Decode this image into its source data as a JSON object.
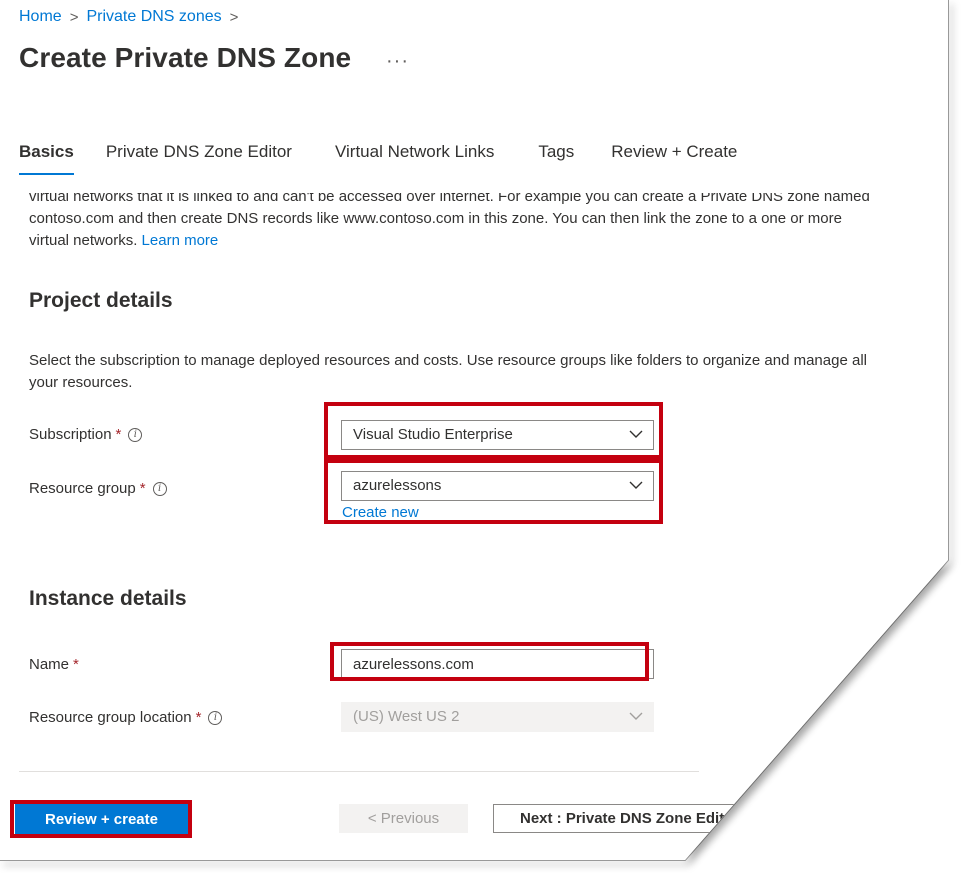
{
  "breadcrumb": {
    "home": "Home",
    "private_dns_zones": "Private DNS zones",
    "separator": ">"
  },
  "page": {
    "title": "Create Private DNS Zone",
    "more": "···"
  },
  "tabs": [
    {
      "label": "Basics",
      "active": true
    },
    {
      "label": "Private DNS Zone Editor"
    },
    {
      "label": "Virtual Network Links"
    },
    {
      "label": "Tags"
    },
    {
      "label": "Review + Create"
    }
  ],
  "intro": {
    "line1": "virtual networks that it is linked to and can't be accessed over internet. For example you can create a Private DNS zone named",
    "line2": "contoso.com and then create DNS records like www.contoso.com in this zone. You can then link the zone to a one or more",
    "line3": "virtual networks.",
    "learn_more": "Learn more"
  },
  "project_details": {
    "heading": "Project details",
    "description_line1": "Select the subscription to manage deployed resources and costs. Use resource groups like folders to organize and manage all",
    "description_line2": "your resources.",
    "subscription": {
      "label": "Subscription",
      "required": "*",
      "value": "Visual Studio Enterprise"
    },
    "resource_group": {
      "label": "Resource group",
      "required": "*",
      "value": "azurelessons",
      "create_new": "Create new"
    }
  },
  "instance_details": {
    "heading": "Instance details",
    "name": {
      "label": "Name",
      "required": "*",
      "value": "azurelessons.com"
    },
    "location": {
      "label": "Resource group location",
      "required": "*",
      "value": "(US) West US 2"
    }
  },
  "footer": {
    "review_create": "Review + create",
    "previous": "< Previous",
    "next": "Next : Private DNS Zone Editor >"
  },
  "colors": {
    "accent": "#0078d4",
    "highlight": "#c4000f",
    "required": "#a4262c"
  },
  "icons": {
    "info": "info-icon",
    "chevron": "chevron-down-icon",
    "more": "more-icon"
  }
}
